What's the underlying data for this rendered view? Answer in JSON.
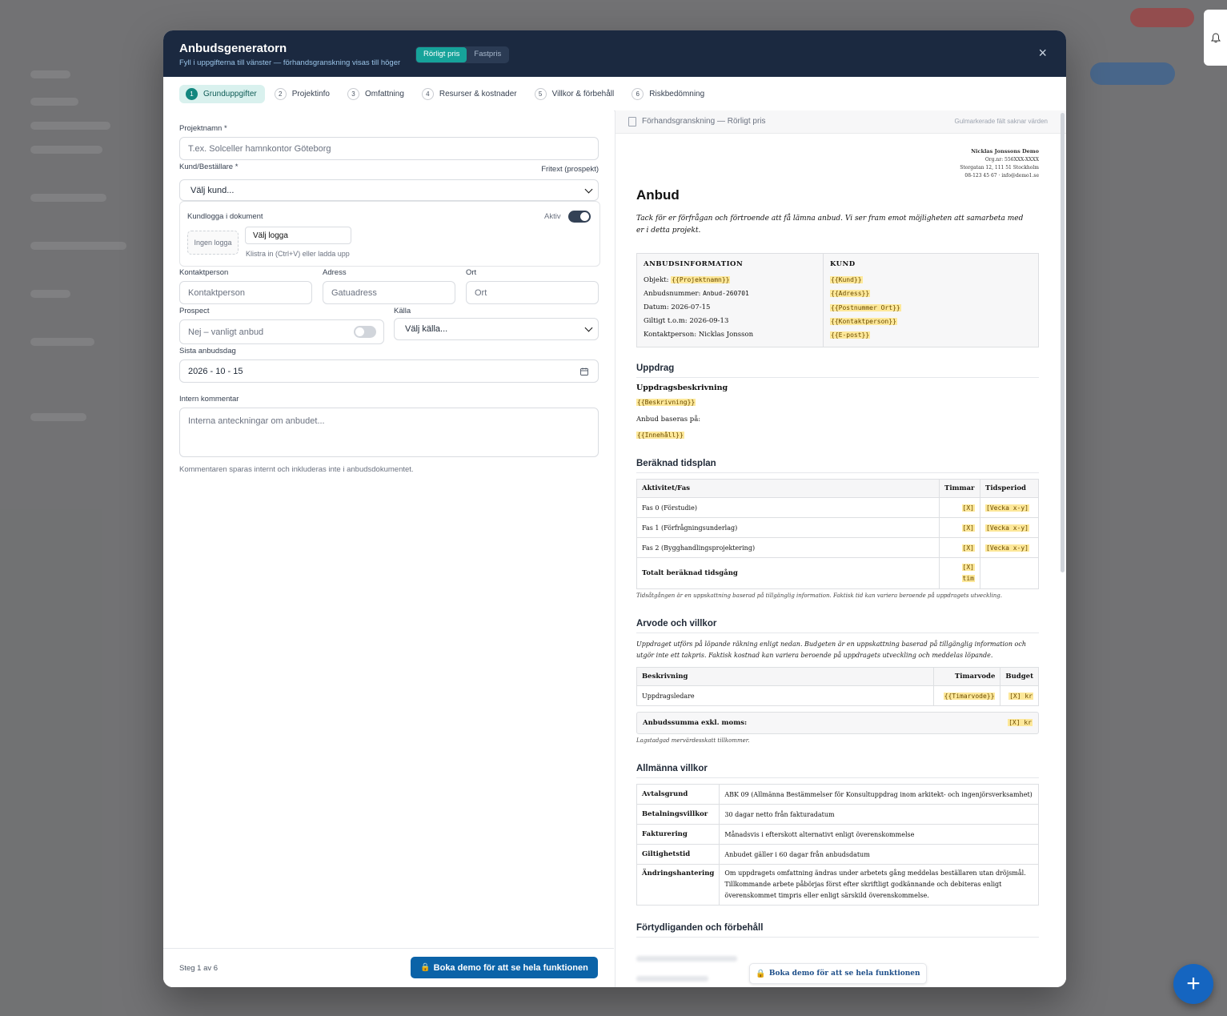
{
  "modal": {
    "title": "Anbudsgeneratorn",
    "subtitle": "Fyll i uppgifterna till vänster — förhandsgranskning visas till höger",
    "modes": [
      "Rörligt pris",
      "Fastpris"
    ],
    "close_label": "×"
  },
  "steps": [
    {
      "num": "1",
      "label": "Grunduppgifter"
    },
    {
      "num": "2",
      "label": "Projektinfo"
    },
    {
      "num": "3",
      "label": "Omfattning"
    },
    {
      "num": "4",
      "label": "Resurser & kostnader"
    },
    {
      "num": "5",
      "label": "Villkor & förbehåll"
    },
    {
      "num": "6",
      "label": "Riskbedömning"
    }
  ],
  "form": {
    "project_name_label": "Projektnamn *",
    "project_name_placeholder": "T.ex. Solceller hamnkontor Göteborg",
    "customer_label": "Kund/Beställare *",
    "customer_freetext": "Fritext (prospekt)",
    "customer_value": "Välj kund...",
    "logo_label": "Kundlogga i dokument",
    "logo_active": "Aktiv",
    "no_logo": "Ingen logga",
    "choose_logo": "Välj logga",
    "logo_hint": "Klistra in (Ctrl+V) eller ladda upp",
    "contact_label": "Kontaktperson",
    "contact_placeholder": "Kontaktperson",
    "address_label": "Adress",
    "address_placeholder": "Gatuadress",
    "city_label": "Ort",
    "city_placeholder": "Ort",
    "prospect_label": "Prospect",
    "prospect_value": "Nej – vanligt anbud",
    "source_label": "Källa",
    "source_value": "Välj källa...",
    "deadline_label": "Sista anbudsdag",
    "deadline_value": "2026 - 10 - 15",
    "comment_label": "Intern kommentar",
    "comment_placeholder": "Interna anteckningar om anbudet...",
    "comment_hint": "Kommentaren sparas internt och inkluderas inte i anbudsdokumentet."
  },
  "footer": {
    "step_text": "Steg 1 av 6",
    "cta": "Boka demo för att se hela funktionen"
  },
  "preview": {
    "title": "Förhandsgranskning — Rörligt pris",
    "hint": "Gulmarkerade fält saknar värden",
    "sender": {
      "name": "Nicklas Jonssons Demo",
      "org": "Org.nr: 556XXX-XXXX",
      "address": "Storgatan 12, 111 51 Stockholm",
      "contact": "08-123 45 67 · info@demo1.se"
    },
    "heading": "Anbud",
    "intro": "Tack för er förfrågan och förtroende att få lämna anbud. Vi ser fram emot möjligheten att samarbeta med er i detta projekt.",
    "info": {
      "title": "ANBUDSINFORMATION",
      "object_label": "Objekt:",
      "object_value": "{{Projektnamn}}",
      "number_label": "Anbudsnummer:",
      "number_value": "Anbud-260701",
      "date_label": "Datum:",
      "date_value": "2026-07-15",
      "valid_label": "Giltigt t.o.m:",
      "valid_value": "2026-09-13",
      "contact_label": "Kontaktperson:",
      "contact_value": "Nicklas Jonsson"
    },
    "customer": {
      "title": "KUND",
      "fields": [
        "{{Kund}}",
        "{{Adress}}",
        "{{Postnummer Ort}}",
        "{{Kontaktperson}}",
        "{{E-post}}"
      ]
    },
    "assignment": {
      "heading": "Uppdrag",
      "sub": "Uppdragsbeskrivning",
      "desc": "{{Beskrivning}}",
      "based_on": "Anbud baseras på:",
      "content": "{{Innehåll}}"
    },
    "schedule": {
      "heading": "Beräknad tidsplan",
      "headers": [
        "Aktivitet/Fas",
        "Timmar",
        "Tidsperiod"
      ],
      "rows": [
        [
          "Fas 0 (Förstudie)",
          "[X]",
          "[Vecka x-y]"
        ],
        [
          "Fas 1 (Förfrågningsunderlag)",
          "[X]",
          "[Vecka x-y]"
        ],
        [
          "Fas 2 (Bygghandlingsprojektering)",
          "[X]",
          "[Vecka x-y]"
        ]
      ],
      "total_label": "Totalt beräknad tidsgång",
      "total_value_1": "[X]",
      "total_value_2": "tim",
      "note": "Tidsåtgången är en uppskattning baserad på tillgänglig information. Faktisk tid kan variera beroende på uppdragets utveckling."
    },
    "fees": {
      "heading": "Arvode och villkor",
      "intro": "Uppdraget utförs på löpande räkning enligt nedan. Budgeten är en uppskattning baserad på tillgänglig information och utgör inte ett takpris. Faktisk kostnad kan variera beroende på uppdragets utveckling och meddelas löpande.",
      "headers": [
        "Beskrivning",
        "Timarvode",
        "Budget"
      ],
      "row": [
        "Uppdragsledare",
        "{{Timarvode}}",
        "[X] kr"
      ],
      "sum_label": "Anbudssumma exkl. moms:",
      "sum_value": "[X] kr",
      "vat_note": "Lagstadgad mervärdesskatt tillkommer."
    },
    "terms": {
      "heading": "Allmänna villkor",
      "rows": [
        [
          "Avtalsgrund",
          "ABK 09 (Allmänna Bestämmelser för Konsultuppdrag inom arkitekt- och ingenjörsverksamhet)"
        ],
        [
          "Betalningsvillkor",
          "30 dagar netto från fakturadatum"
        ],
        [
          "Fakturering",
          "Månadsvis i efterskott alternativt enligt överenskommelse"
        ],
        [
          "Giltighetstid",
          "Anbudet gäller i 60 dagar från anbudsdatum"
        ],
        [
          "Ändringshantering",
          "Om uppdragets omfattning ändras under arbetets gång meddelas beställaren utan dröjsmål. Tillkommande arbete påbörjas först efter skriftligt godkännande och debiteras enligt överenskommet timpris eller enligt särskild överenskommelse."
        ]
      ]
    },
    "clarifications_heading": "Förtydliganden och förbehåll",
    "cta": "Boka demo för att se hela funktionen"
  },
  "colors": {
    "header": "#1b2940",
    "accent": "#16a39a",
    "cta": "#0b63a8",
    "placeholder": "#fde89a"
  }
}
